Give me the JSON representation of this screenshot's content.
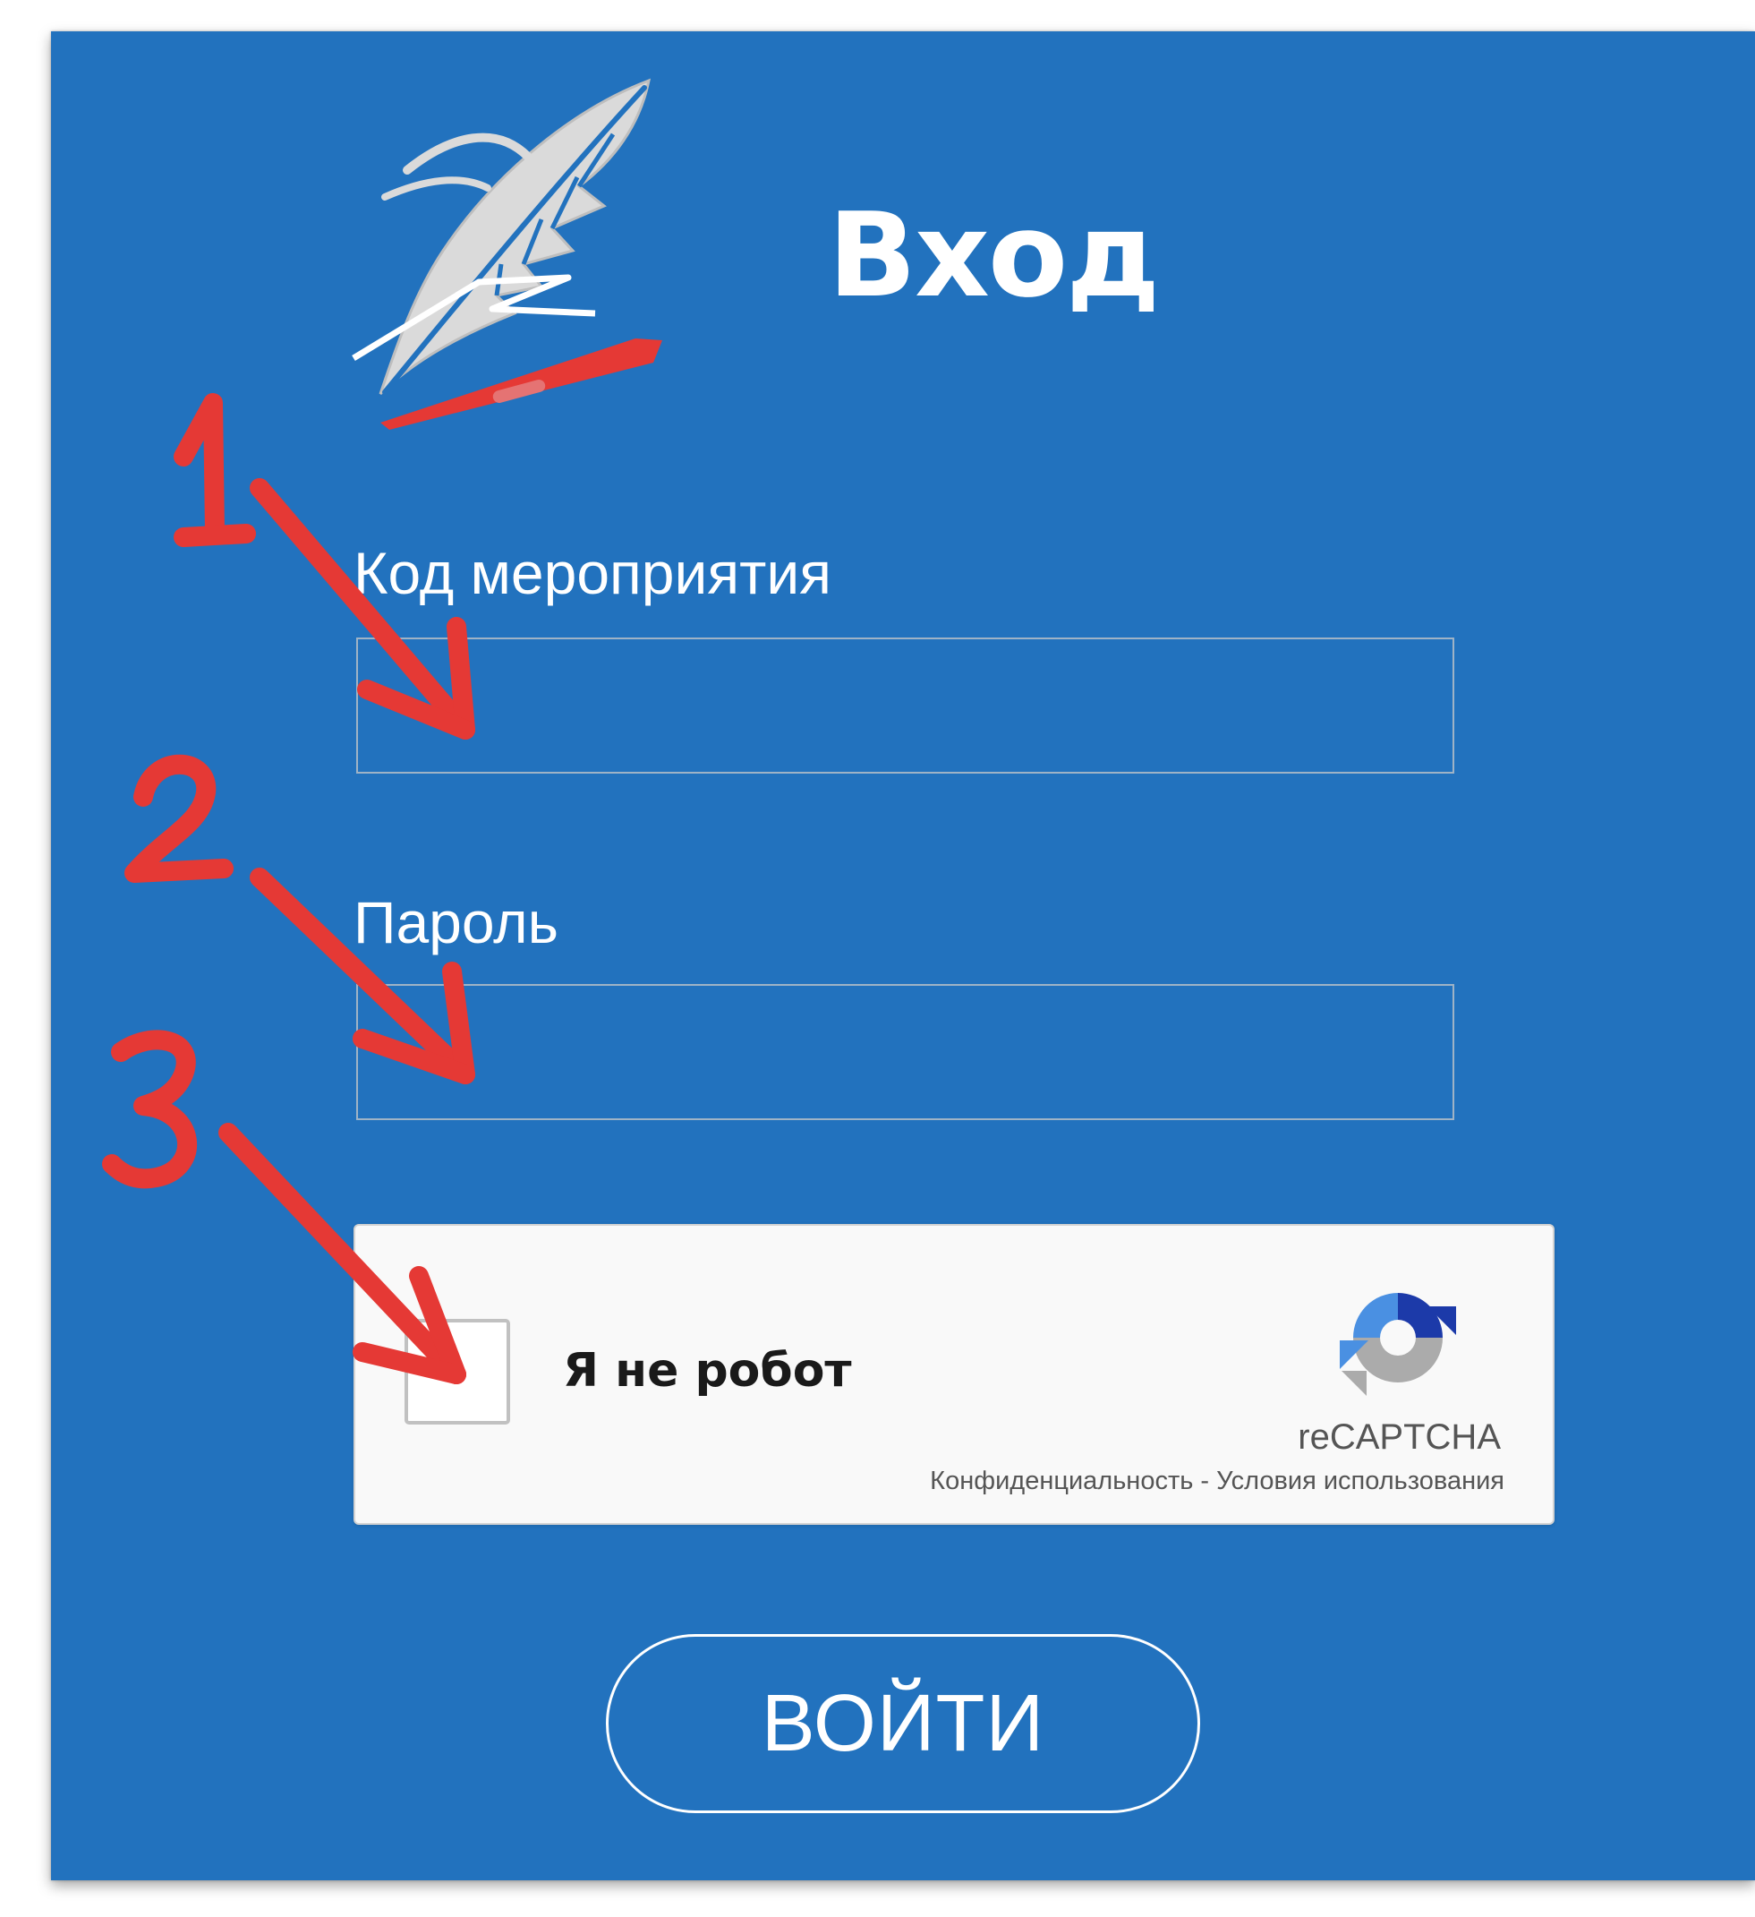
{
  "login": {
    "title": "Вход",
    "event_code_label": "Код мероприятия",
    "event_code_value": "",
    "password_label": "Пароль",
    "password_value": "",
    "submit_label": "ВОЙТИ"
  },
  "recaptcha": {
    "checkbox_label": "Я не робот",
    "brand": "reCAPTCHA",
    "privacy_label": "Конфиденциальность",
    "separator": " - ",
    "terms_label": "Условия использования",
    "checked": false
  },
  "annotations": {
    "markers": [
      "1",
      "2",
      "3"
    ],
    "color": "#E53935"
  },
  "icons": {
    "logo": "feather-quill-logo-icon",
    "recaptcha": "recaptcha-logo-icon"
  },
  "colors": {
    "background": "#2272BE",
    "text": "#FFFFFF",
    "accent_red": "#E53935"
  }
}
